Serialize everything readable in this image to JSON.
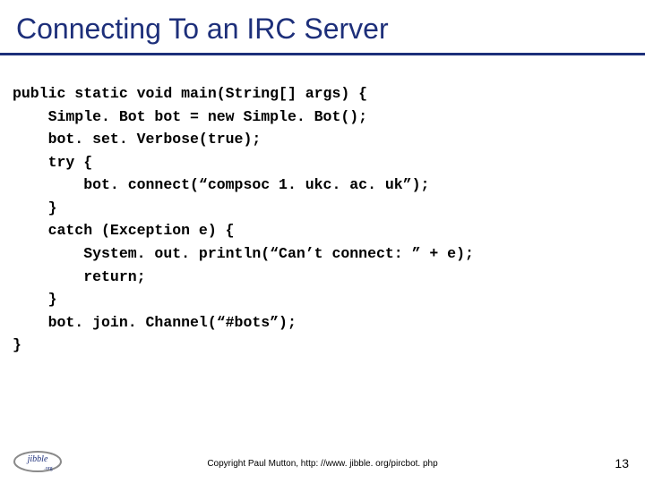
{
  "title": "Connecting To an IRC Server",
  "code": {
    "l0": "public static void main(String[] args) {",
    "l1": "    Simple. Bot bot = new Simple. Bot();",
    "l2": "    bot. set. Verbose(true);",
    "l3": "    try {",
    "l4": "        bot. connect(“compsoc 1. ukc. ac. uk”);",
    "l5": "    }",
    "l6": "    catch (Exception e) {",
    "l7": "        System. out. println(“Can’t connect: ” + e);",
    "l8": "        return;",
    "l9": "    }",
    "l10": "    bot. join. Channel(“#bots”);",
    "l11": "}"
  },
  "footer": {
    "copyright": "Copyright Paul Mutton, http: //www. jibble. org/pircbot. php",
    "page": "13",
    "logo_text_top": "jibble",
    "logo_text_bottom": ".org"
  }
}
